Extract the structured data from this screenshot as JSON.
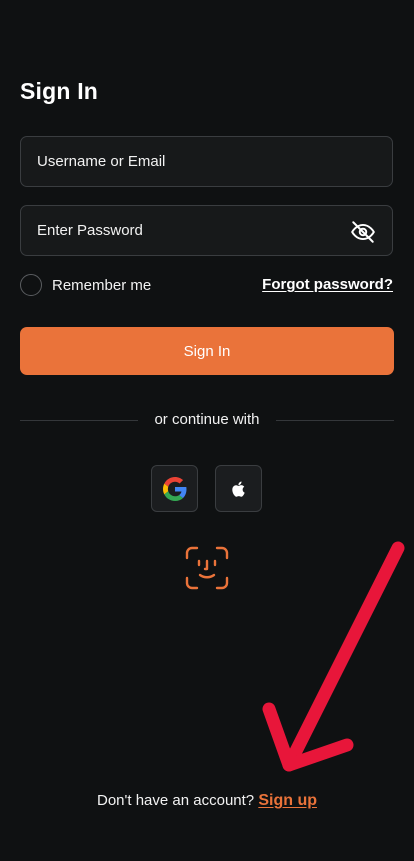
{
  "page": {
    "title": "Sign In"
  },
  "form": {
    "username": {
      "value": "",
      "placeholder": "Username or Email"
    },
    "password": {
      "value": "",
      "placeholder": "Enter Password",
      "toggle_icon": "eye-off-icon"
    },
    "remember_label": "Remember me",
    "remember_checked": false,
    "forgot_label": "Forgot password?",
    "submit_label": "Sign In"
  },
  "divider": {
    "label": "or continue with"
  },
  "social": [
    {
      "icon": "google-icon"
    },
    {
      "icon": "apple-icon"
    }
  ],
  "biometric": {
    "icon": "face-id-icon"
  },
  "footer": {
    "prompt": "Don't have an account?",
    "link_label": "Sign up"
  },
  "annotation": {
    "icon": "red-arrow-icon",
    "color": "#e8163a"
  },
  "colors": {
    "background": "#0f1112",
    "accent": "#ea733a",
    "field_bg": "#17191a",
    "field_border": "#3a3d40"
  }
}
